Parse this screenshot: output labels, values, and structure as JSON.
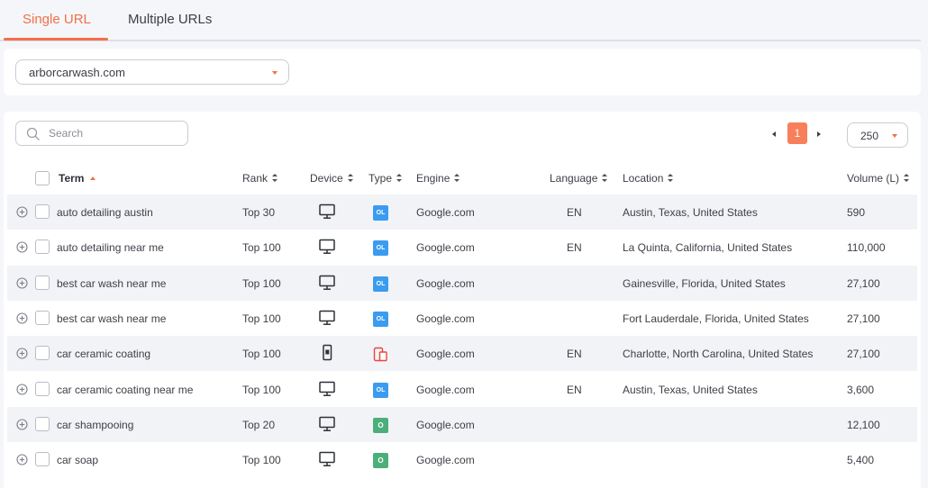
{
  "tabs": [
    {
      "label": "Single URL",
      "active": true
    },
    {
      "label": "Multiple URLs",
      "active": false
    }
  ],
  "url_select": {
    "value": "arborcarwash.com"
  },
  "search": {
    "placeholder": "Search"
  },
  "pagination": {
    "current_page": "1",
    "per_page": "250"
  },
  "columns": {
    "term": "Term",
    "rank": "Rank",
    "device": "Device",
    "type": "Type",
    "engine": "Engine",
    "language": "Language",
    "location": "Location",
    "volume": "Volume (L)"
  },
  "rows": [
    {
      "term": "auto detailing austin",
      "rank": "Top 30",
      "device": "desktop",
      "type": "OL",
      "engine": "Google.com",
      "language": "EN",
      "location": "Austin, Texas, United States",
      "volume": "590"
    },
    {
      "term": "auto detailing near me",
      "rank": "Top 100",
      "device": "desktop",
      "type": "OL",
      "engine": "Google.com",
      "language": "EN",
      "location": "La Quinta, California, United States",
      "volume": "110,000"
    },
    {
      "term": "best car wash near me",
      "rank": "Top 100",
      "device": "desktop",
      "type": "OL",
      "engine": "Google.com",
      "language": "",
      "location": "Gainesville, Florida, United States",
      "volume": "27,100"
    },
    {
      "term": "best car wash near me",
      "rank": "Top 100",
      "device": "desktop",
      "type": "OL",
      "engine": "Google.com",
      "language": "",
      "location": "Fort Lauderdale, Florida, United States",
      "volume": "27,100"
    },
    {
      "term": "car ceramic coating",
      "rank": "Top 100",
      "device": "mobile",
      "type": "mobile",
      "engine": "Google.com",
      "language": "EN",
      "location": "Charlotte, North Carolina, United States",
      "volume": "27,100"
    },
    {
      "term": "car ceramic coating near me",
      "rank": "Top 100",
      "device": "desktop",
      "type": "OL",
      "engine": "Google.com",
      "language": "EN",
      "location": "Austin, Texas, United States",
      "volume": "3,600"
    },
    {
      "term": "car shampooing",
      "rank": "Top 20",
      "device": "desktop",
      "type": "O",
      "engine": "Google.com",
      "language": "",
      "location": "",
      "volume": "12,100"
    },
    {
      "term": "car soap",
      "rank": "Top 100",
      "device": "desktop",
      "type": "O",
      "engine": "Google.com",
      "language": "",
      "location": "",
      "volume": "5,400"
    }
  ],
  "colors": {
    "accent": "#f27049",
    "type_ol": "#3b9cef",
    "type_o": "#4caf7a",
    "type_mobile": "#e8473f"
  }
}
